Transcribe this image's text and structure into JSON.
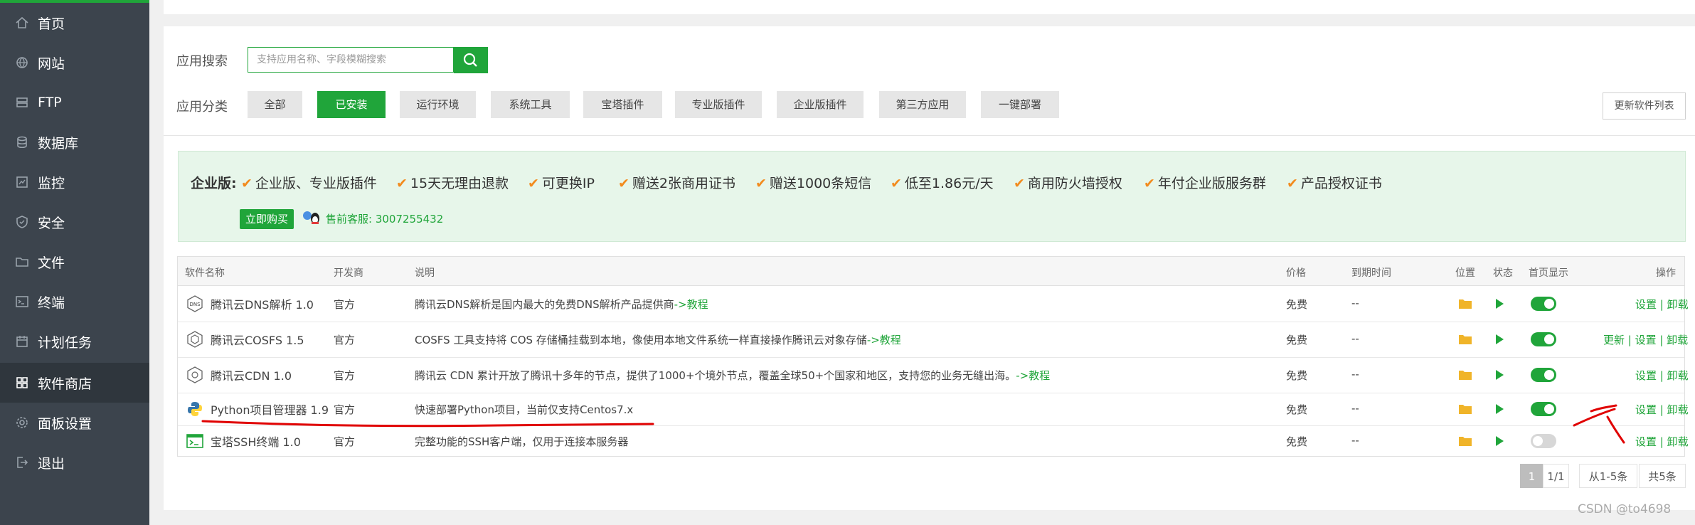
{
  "sidebar": {
    "items": [
      {
        "label": "首页",
        "icon": "home-icon"
      },
      {
        "label": "网站",
        "icon": "globe-icon"
      },
      {
        "label": "FTP",
        "icon": "ftp-icon"
      },
      {
        "label": "数据库",
        "icon": "database-icon"
      },
      {
        "label": "监控",
        "icon": "monitor-icon"
      },
      {
        "label": "安全",
        "icon": "shield-icon"
      },
      {
        "label": "文件",
        "icon": "folder-icon"
      },
      {
        "label": "终端",
        "icon": "terminal-icon"
      },
      {
        "label": "计划任务",
        "icon": "calendar-icon"
      },
      {
        "label": "软件商店",
        "icon": "grid-icon"
      },
      {
        "label": "面板设置",
        "icon": "gear-icon"
      },
      {
        "label": "退出",
        "icon": "logout-icon"
      }
    ],
    "active_index": 9
  },
  "search": {
    "label": "应用搜索",
    "placeholder": "支持应用名称、字段模糊搜索"
  },
  "categories": {
    "label": "应用分类",
    "items": [
      "全部",
      "已安装",
      "运行环境",
      "系统工具",
      "宝塔插件",
      "专业版插件",
      "企业版插件",
      "第三方应用",
      "一键部署"
    ],
    "active": "已安装"
  },
  "refresh_label": "更新软件列表",
  "banner": {
    "title": "企业版:",
    "features": [
      "企业版、专业版插件",
      "15天无理由退款",
      "可更换IP",
      "赠送2张商用证书",
      "赠送1000条短信",
      "低至1.86元/天",
      "商用防火墙授权",
      "年付企业版服务群",
      "产品授权证书"
    ],
    "buy_label": "立即购买",
    "service": "售前客服: 3007255432"
  },
  "table": {
    "headers": {
      "name": "软件名称",
      "dev": "开发商",
      "desc": "说明",
      "price": "价格",
      "expire": "到期时间",
      "pos": "位置",
      "state": "状态",
      "home": "首页显示",
      "ops": "操作"
    },
    "rows": [
      {
        "name": "腾讯云DNS解析 1.0",
        "dev": "官方",
        "desc": "腾讯云DNS解析是国内最大的免费DNS解析产品提供商",
        "tutorial": "->教程",
        "price": "免费",
        "expire": "--",
        "home_on": true,
        "ops": "设置 | 卸载",
        "icon": "dns-icon"
      },
      {
        "name": "腾讯云COSFS 1.5",
        "dev": "官方",
        "desc": "COSFS 工具支持将 COS 存储桶挂载到本地，像使用本地文件系统一样直接操作腾讯云对象存储",
        "tutorial": "->教程",
        "price": "免费",
        "expire": "--",
        "home_on": true,
        "ops": "更新 | 设置 | 卸载",
        "icon": "cosfs-icon"
      },
      {
        "name": "腾讯云CDN 1.0",
        "dev": "官方",
        "desc": "腾讯云 CDN 累计开放了腾讯十多年的节点，提供了1000+个境外节点，覆盖全球50+个国家和地区，支持您的业务无缝出海。",
        "tutorial": "->教程",
        "price": "免费",
        "expire": "--",
        "home_on": true,
        "ops": "设置 | 卸载",
        "icon": "cdn-icon"
      },
      {
        "name": "Python项目管理器 1.9",
        "dev": "官方",
        "desc": "快速部署Python项目，当前仅支持Centos7.x",
        "tutorial": "",
        "price": "免费",
        "expire": "--",
        "home_on": true,
        "ops": "设置 | 卸载",
        "icon": "python-icon"
      },
      {
        "name": "宝塔SSH终端 1.0",
        "dev": "官方",
        "desc": "完整功能的SSH客户端，仅用于连接本服务器",
        "tutorial": "",
        "price": "免费",
        "expire": "--",
        "home_on": false,
        "ops": "设置 | 卸载",
        "icon": "ssh-terminal-icon"
      }
    ]
  },
  "pagination": {
    "current": "1",
    "pages": "1/1",
    "range": "从1-5条",
    "total": "共5条"
  },
  "watermark": "CSDN @to4698",
  "colors": {
    "accent": "#20a53a",
    "sidebar": "#3c444d",
    "check": "#f28b1e",
    "annotation": "#e00000"
  }
}
